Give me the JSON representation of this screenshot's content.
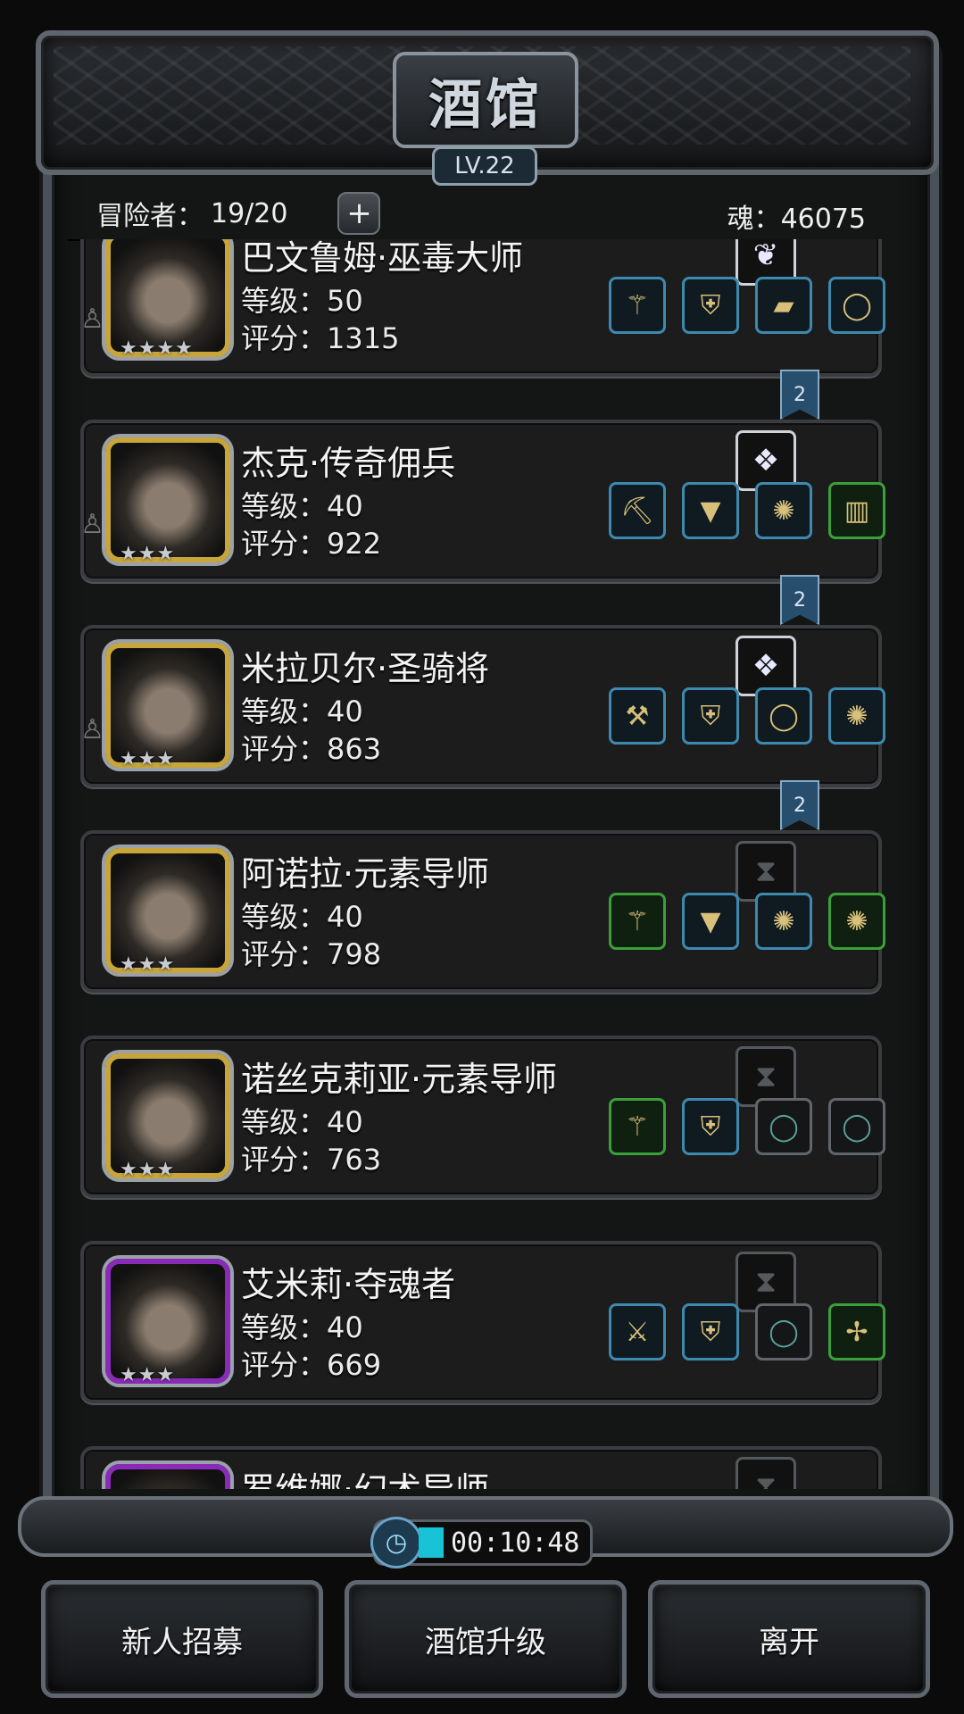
{
  "tavern": {
    "title": "酒馆",
    "level": "LV.22",
    "adventurers_label": "冒险者：",
    "adventurers_count": "19/20",
    "add_symbol": "+",
    "soul_label": "魂：",
    "soul_value": "46075"
  },
  "heroes": [
    {
      "name": "巴文鲁姆·巫毒大师",
      "level": "等级：50",
      "score": "评分：1315",
      "stars": "★★★★",
      "frame": "gold",
      "badge": "2",
      "top_item": "feather-icon",
      "items": [
        "staff-icon",
        "armor-icon",
        "plank-icon",
        "ring-icon"
      ]
    },
    {
      "name": "杰克·传奇佣兵",
      "level": "等级：40",
      "score": "评分：922",
      "stars": "★★★",
      "frame": "gold",
      "badge": "2",
      "top_item": "crystal-icon",
      "items": [
        "pickaxe-icon",
        "cloak-icon",
        "amulet-icon",
        "barrel-icon"
      ]
    },
    {
      "name": "米拉贝尔·圣骑将",
      "level": "等级：40",
      "score": "评分：863",
      "stars": "★★★",
      "frame": "gold",
      "badge": "2",
      "top_item": "crystal-icon",
      "items": [
        "scepter-icon",
        "armor-icon",
        "ring-icon",
        "amulet-icon"
      ]
    },
    {
      "name": "阿诺拉·元素导师",
      "level": "等级：40",
      "score": "评分：798",
      "stars": "★★★",
      "frame": "gold",
      "badge": "",
      "top_item": "empty-slot-icon",
      "items": [
        "staff-icon",
        "cloak-icon",
        "amulet-icon",
        "amulet-icon"
      ]
    },
    {
      "name": "诺丝克莉亚·元素导师",
      "level": "等级：40",
      "score": "评分：763",
      "stars": "★★★",
      "frame": "gold",
      "badge": "",
      "top_item": "empty-slot-icon",
      "items": [
        "staff-icon",
        "armor-icon",
        "ring-icon",
        "ring-icon"
      ]
    },
    {
      "name": "艾米莉·夺魂者",
      "level": "等级：40",
      "score": "评分：669",
      "stars": "★★★",
      "frame": "purple",
      "badge": "",
      "top_item": "empty-slot-icon",
      "items": [
        "axe-icon",
        "armor-icon",
        "ring-icon",
        "chain-icon"
      ]
    },
    {
      "name": "罗维娜·幻术导师",
      "level": "",
      "score": "",
      "stars": "",
      "frame": "purple",
      "badge": "",
      "top_item": "empty-slot-icon",
      "items": []
    }
  ],
  "timer": {
    "time": "00:10:48",
    "progress": 0.1
  },
  "buttons": {
    "recruit": "新人招募",
    "upgrade": "酒馆升级",
    "leave": "离开"
  }
}
